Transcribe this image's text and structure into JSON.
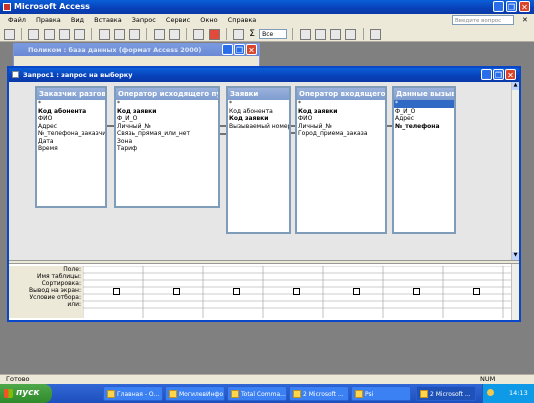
{
  "app": {
    "title": "Microsoft Access",
    "help_placeholder": "Введите вопрос"
  },
  "menu": [
    "Файл",
    "Правка",
    "Вид",
    "Вставка",
    "Запрос",
    "Сервис",
    "Окно",
    "Справка"
  ],
  "toolbar": {
    "totals": "Σ",
    "top_values": "Все"
  },
  "db_window": {
    "title": "Поликом : база данных (формат Access 2000)"
  },
  "query_window": {
    "title": "Запрос1 : запрос на выборку",
    "tables": [
      {
        "name": "Заказчик разговора",
        "fields": [
          {
            "t": "*"
          },
          {
            "t": "Код абонента",
            "b": true
          },
          {
            "t": "ФИО"
          },
          {
            "t": "Адрес"
          },
          {
            "t": "№_телефона_заказчика"
          },
          {
            "t": "Дата"
          },
          {
            "t": "Время"
          }
        ]
      },
      {
        "name": "Оператор исходящего пункта",
        "fields": [
          {
            "t": "*"
          },
          {
            "t": "Код заявки",
            "b": true
          },
          {
            "t": "Ф_И_О"
          },
          {
            "t": "Личный_№"
          },
          {
            "t": "Связь_прямая_или_нет"
          },
          {
            "t": "Зона"
          },
          {
            "t": "Тариф"
          }
        ]
      },
      {
        "name": "Заявки",
        "fields": [
          {
            "t": "*"
          },
          {
            "t": "Код абонента"
          },
          {
            "t": "Код заявки",
            "b": true
          },
          {
            "t": "Вызываемый номер"
          }
        ]
      },
      {
        "name": "Оператор входящего п...",
        "fields": [
          {
            "t": "*"
          },
          {
            "t": "Код заявки",
            "b": true
          },
          {
            "t": "ФИО"
          },
          {
            "t": "Личный_№"
          },
          {
            "t": "Город_приема_заказа"
          }
        ]
      },
      {
        "name": "Данные вызыв...",
        "fields": [
          {
            "t": "*",
            "sel": true
          },
          {
            "t": "Ф_И_О"
          },
          {
            "t": "Адрес"
          },
          {
            "t": "№_телефона",
            "b": true
          }
        ]
      }
    ],
    "grid_rows": [
      "Поле:",
      "Имя таблицы:",
      "Сортировка:",
      "Вывод на экран:",
      "Условие отбора:",
      "или:"
    ]
  },
  "status": {
    "left": "Готово",
    "right": "NUM"
  },
  "taskbar": {
    "start": "пуск",
    "items": [
      "Главная - О...",
      "МогилевИнфо",
      "Total Comma...",
      "2 Microsoft ...",
      "Psi",
      "2 Microsoft ..."
    ],
    "clock": "14:13"
  }
}
